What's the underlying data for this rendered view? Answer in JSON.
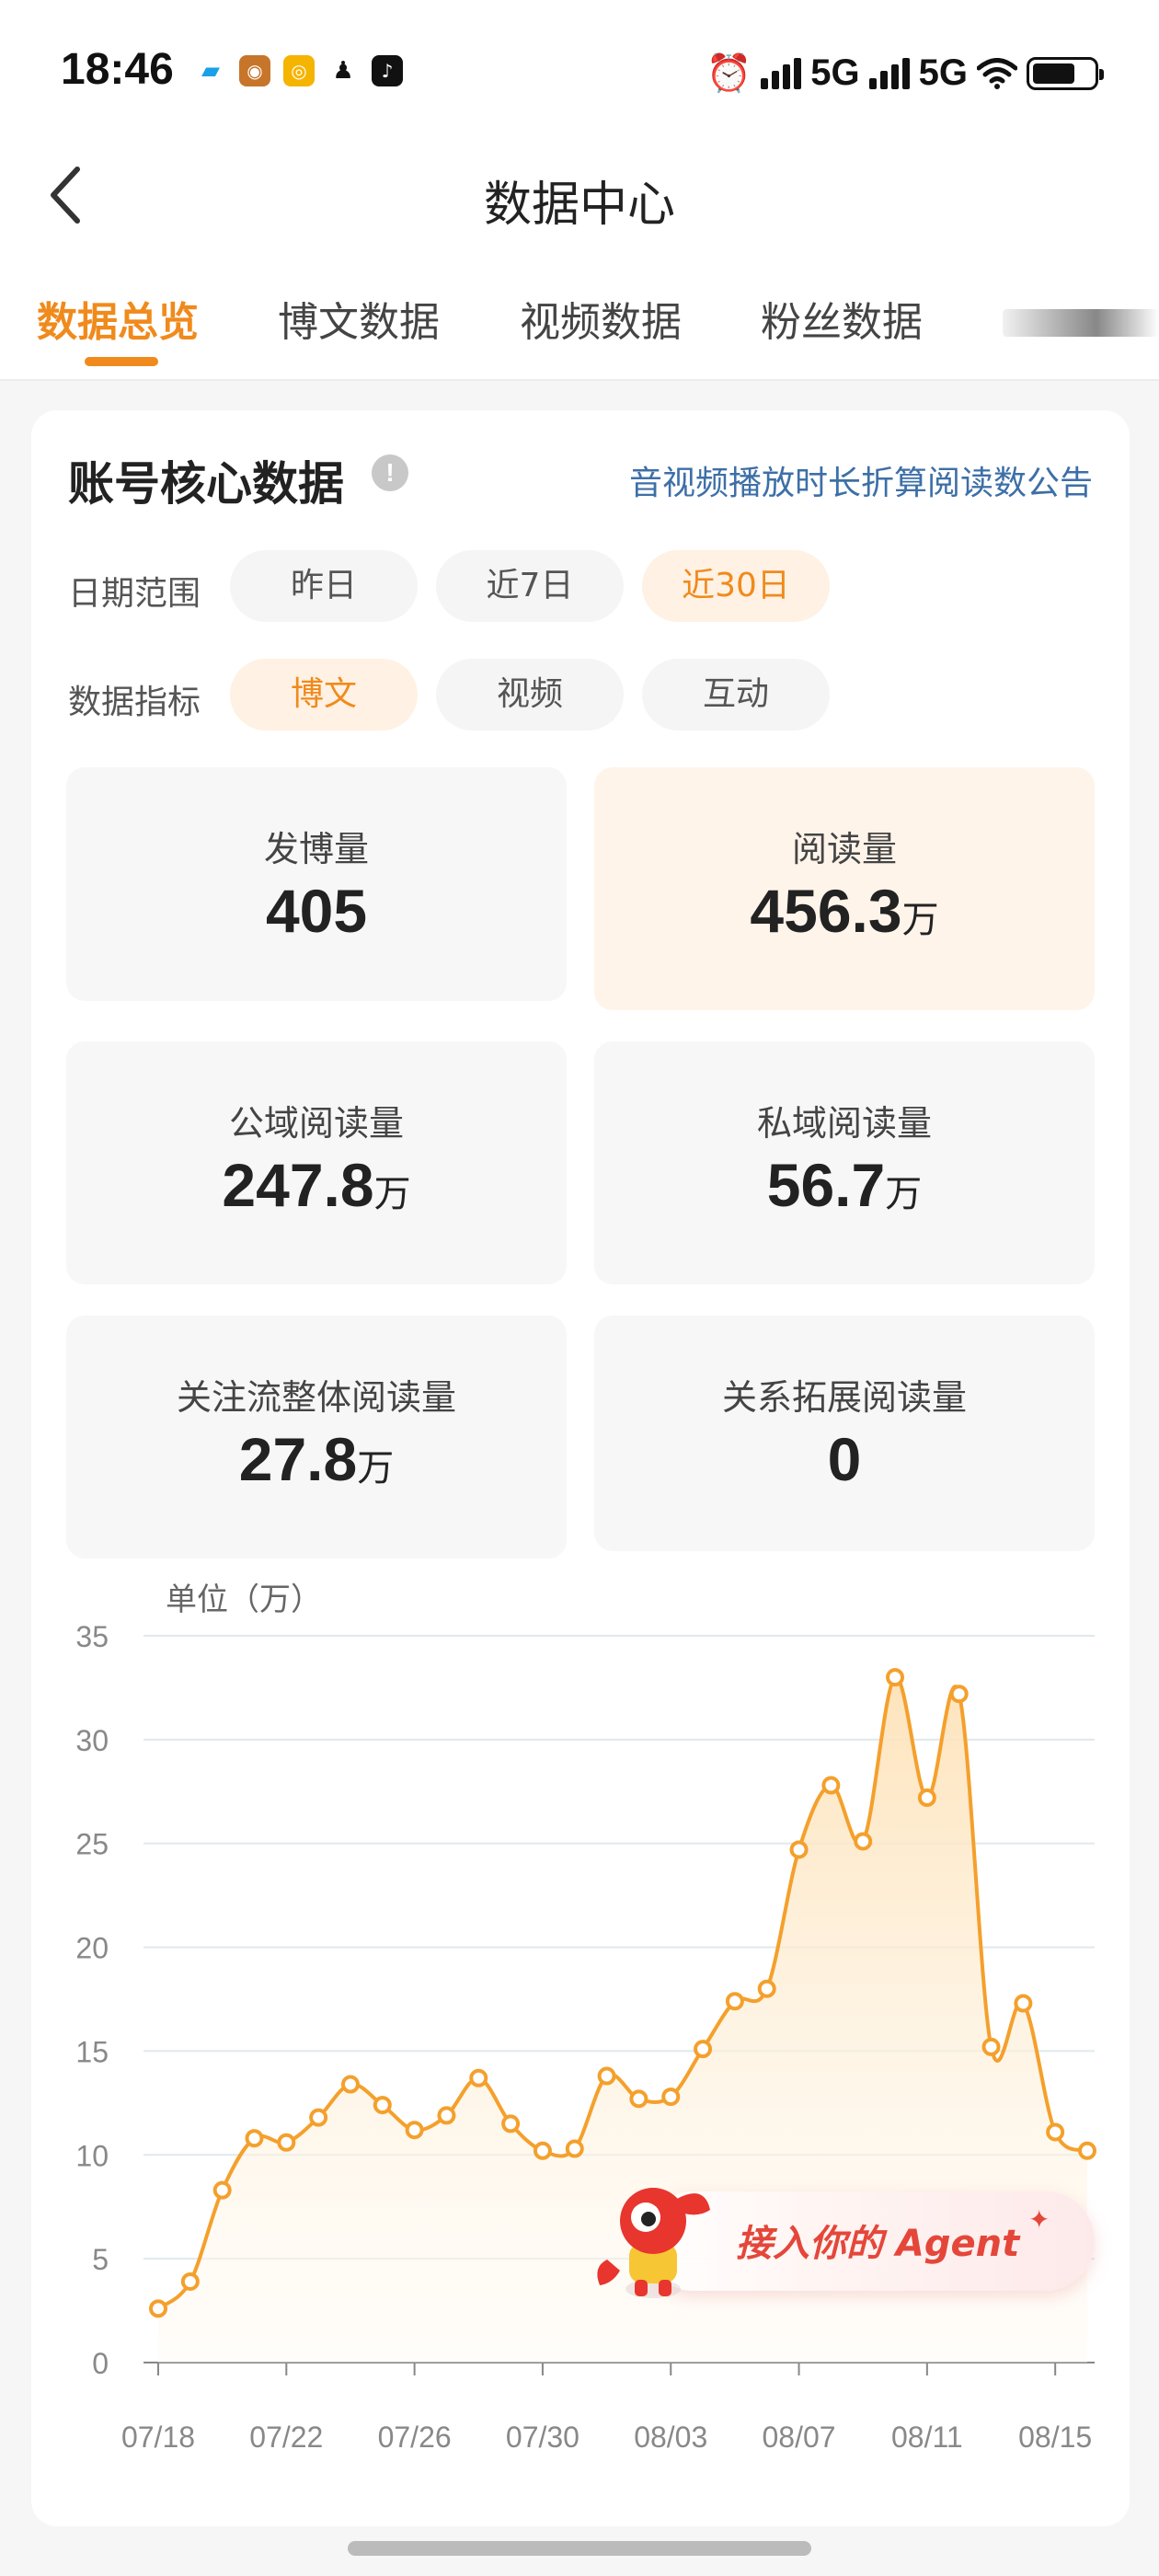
{
  "status_bar": {
    "time": "18:46",
    "network_1": "5G",
    "network_2": "5G",
    "icons": [
      "alarm-icon",
      "signal-icon",
      "wifi-icon",
      "battery-icon"
    ]
  },
  "nav": {
    "title": "数据中心",
    "back_icon": "chevron-left-icon"
  },
  "tabs": [
    {
      "label": "数据总览",
      "active": true
    },
    {
      "label": "博文数据",
      "active": false
    },
    {
      "label": "视频数据",
      "active": false
    },
    {
      "label": "粉丝数据",
      "active": false
    }
  ],
  "core": {
    "title": "账号核心数据",
    "info_icon": "!",
    "notice_link": "音视频播放时长折算阅读数公告",
    "date_range": {
      "label": "日期范围",
      "options": [
        "昨日",
        "近7日",
        "近30日"
      ],
      "selected": "近30日"
    },
    "indicator": {
      "label": "数据指标",
      "options": [
        "博文",
        "视频",
        "互动"
      ],
      "selected": "博文"
    },
    "metrics": [
      {
        "label": "发博量",
        "value": "405",
        "unit": ""
      },
      {
        "label": "阅读量",
        "value": "456.3",
        "unit": "万"
      },
      {
        "label": "公域阅读量",
        "value": "247.8",
        "unit": "万"
      },
      {
        "label": "私域阅读量",
        "value": "56.7",
        "unit": "万"
      },
      {
        "label": "关注流整体阅读量",
        "value": "27.8",
        "unit": "万"
      },
      {
        "label": "关系拓展阅读量",
        "value": "0",
        "unit": ""
      }
    ]
  },
  "chart_data": {
    "type": "area",
    "unit_label": "单位（万）",
    "ylim": [
      0,
      35
    ],
    "y_ticks": [
      0,
      5,
      10,
      15,
      20,
      25,
      30,
      35
    ],
    "x_tick_labels": [
      "07/18",
      "07/22",
      "07/26",
      "07/30",
      "08/03",
      "08/07",
      "08/11",
      "08/15"
    ],
    "x": [
      "07/18",
      "07/19",
      "07/20",
      "07/21",
      "07/22",
      "07/23",
      "07/24",
      "07/25",
      "07/26",
      "07/27",
      "07/28",
      "07/29",
      "07/30",
      "07/31",
      "08/01",
      "08/02",
      "08/03",
      "08/04",
      "08/05",
      "08/06",
      "08/07",
      "08/08",
      "08/09",
      "08/10",
      "08/11",
      "08/12",
      "08/13",
      "08/14",
      "08/15",
      "08/16"
    ],
    "values": [
      2.6,
      3.9,
      8.3,
      10.8,
      10.6,
      11.8,
      13.4,
      12.4,
      11.2,
      11.9,
      13.7,
      11.5,
      10.2,
      10.3,
      13.8,
      12.7,
      12.8,
      15.1,
      17.4,
      18.0,
      24.7,
      27.8,
      25.1,
      33.0,
      27.2,
      32.2,
      15.2,
      17.3,
      11.1,
      10.2
    ],
    "grid": true,
    "color": "#f4a02c",
    "fill_top": "#fde2b8",
    "fill_bottom": "#fffaf2"
  },
  "agent_badge": {
    "text": "接入你的 Agent",
    "spark": "✦"
  },
  "colors": {
    "accent": "#f08a1c",
    "link": "#3d6fa7",
    "agent": "#e4473a"
  }
}
